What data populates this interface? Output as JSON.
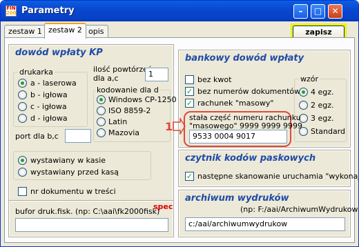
{
  "window": {
    "title": "Parametry",
    "app_icon_lines": [
      "FIN",
      "2000"
    ]
  },
  "tabs": [
    {
      "label": "zestaw 1"
    },
    {
      "label": "zestaw 2"
    },
    {
      "label": "opis"
    }
  ],
  "toolbar": {
    "save_label": "zapisz"
  },
  "kp": {
    "title": "dowód wpłaty  KP",
    "printer": {
      "label": "drukarka",
      "options": [
        "a - laserowa",
        "b - igłowa",
        "c - igłowa",
        "d - igłowa"
      ],
      "selected": "a - laserowa"
    },
    "copies": {
      "label_line1": "ilość powtórzeń",
      "label_line2": "dla a,c",
      "value": "1"
    },
    "encoding": {
      "label": "kodowanie dla d",
      "options": [
        "Windows CP-1250",
        "ISO 8859-2",
        "Latin",
        "Mazovia"
      ],
      "selected": "Windows CP-1250"
    },
    "port": {
      "label": "port dla b,c",
      "value": ""
    },
    "issued": {
      "options": [
        "wystawiany w kasie",
        "wystawiany przed kasą"
      ],
      "selected": "wystawiany w kasie"
    },
    "doc_no_in_content": {
      "label": "nr dokumentu w treści",
      "checked": false
    }
  },
  "fiscal": {
    "label": "bufor druk.fisk. (np: C:\\aai\\fk2000fisk)",
    "spec": "spec",
    "value": ""
  },
  "bank": {
    "title": "bankowy dowód wpłaty",
    "checks": [
      {
        "label": "bez kwot",
        "checked": false
      },
      {
        "label": "bez numerów dokumentów",
        "checked": true
      },
      {
        "label": "rachunek \"masowy\"",
        "checked": true
      }
    ],
    "pattern": {
      "label": "wzór",
      "options": [
        "4 egz.",
        "2 egz.",
        "3 egz.",
        "Standard"
      ],
      "selected": "4 egz."
    },
    "fixed_part": {
      "line1": "stała część numeru rachunku",
      "line2": "\"masowego\" 9999 9999 9999",
      "value": "9533 0004 9017"
    },
    "callout_number": "1"
  },
  "barcode": {
    "title": "czytnik kodów paskowych",
    "next_scan": {
      "label": "następne skanowanie uruchamia \"wykonaj\"",
      "checked": true
    }
  },
  "archive": {
    "title": "archiwum wydruków",
    "hint": "(np: F:/aai/ArchiwumWydrukow)",
    "value": "c:/aai/archiwumwydrukow"
  }
}
